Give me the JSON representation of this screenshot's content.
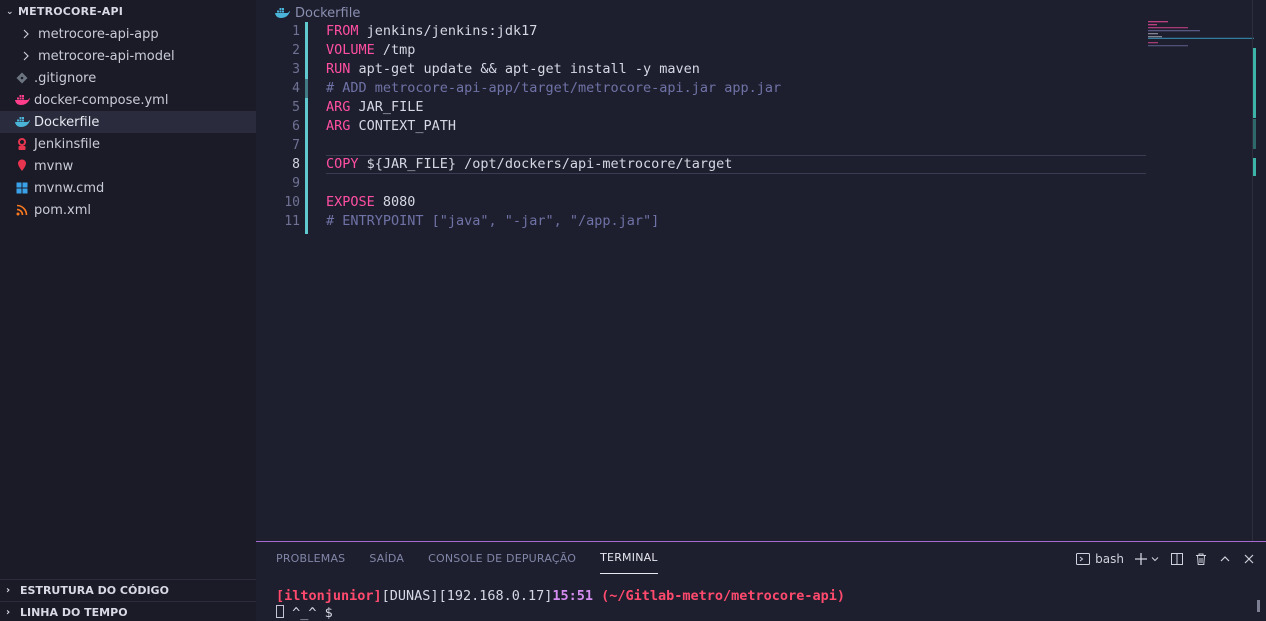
{
  "sidebar": {
    "root_label": "METROCORE-API",
    "items": [
      {
        "label": "metrocore-api-app",
        "kind": "folder",
        "icon": "chevron-right-icon"
      },
      {
        "label": "metrocore-api-model",
        "kind": "folder",
        "icon": "chevron-right-icon"
      },
      {
        "label": ".gitignore",
        "kind": "file",
        "icon": "git-icon",
        "color": "#6b7480"
      },
      {
        "label": "docker-compose.yml",
        "kind": "file",
        "icon": "docker-icon",
        "color": "#ff3d8b"
      },
      {
        "label": "Dockerfile",
        "kind": "file",
        "icon": "docker-icon",
        "color": "#4ab5d9",
        "active": true
      },
      {
        "label": "Jenkinsfile",
        "kind": "file",
        "icon": "jenkins-icon",
        "color": "#e8354f"
      },
      {
        "label": "mvnw",
        "kind": "file",
        "icon": "maven-pin-icon",
        "color": "#e8354f"
      },
      {
        "label": "mvnw.cmd",
        "kind": "file",
        "icon": "windows-icon",
        "color": "#3aa0e8"
      },
      {
        "label": "pom.xml",
        "kind": "file",
        "icon": "rss-icon",
        "color": "#ff7a1f"
      }
    ],
    "outline_label": "ESTRUTURA DO CÓDIGO",
    "timeline_label": "LINHA DO TEMPO"
  },
  "editor": {
    "breadcrumb": "Dockerfile",
    "current_line": 8,
    "lines": [
      {
        "n": "1",
        "kw": "FROM",
        "rest": " jenkins/jenkins:jdk17",
        "comment": ""
      },
      {
        "n": "2",
        "kw": "VOLUME",
        "rest": " /tmp",
        "comment": ""
      },
      {
        "n": "3",
        "kw": "RUN",
        "rest": " apt-get update && apt-get install -y maven",
        "comment": ""
      },
      {
        "n": "4",
        "kw": "",
        "rest": "",
        "comment": "# ADD metrocore-api-app/target/metrocore-api.jar app.jar"
      },
      {
        "n": "5",
        "kw": "ARG",
        "rest": " JAR_FILE",
        "comment": ""
      },
      {
        "n": "6",
        "kw": "ARG",
        "rest": " CONTEXT_PATH",
        "comment": ""
      },
      {
        "n": "7",
        "kw": "",
        "rest": "",
        "comment": ""
      },
      {
        "n": "8",
        "kw": "COPY",
        "rest": " ${JAR_FILE} /opt/dockers/api-metrocore/target",
        "comment": ""
      },
      {
        "n": "9",
        "kw": "",
        "rest": "",
        "comment": ""
      },
      {
        "n": "10",
        "kw": "EXPOSE",
        "rest": " 8080",
        "comment": ""
      },
      {
        "n": "11",
        "kw": "",
        "rest": "",
        "comment": "# ENTRYPOINT [\"java\", \"-jar\", \"/app.jar\"]"
      }
    ]
  },
  "panel": {
    "tabs": [
      "PROBLEMAS",
      "SAÍDA",
      "CONSOLE DE DEPURAÇÃO",
      "TERMINAL"
    ],
    "active_tab": "TERMINAL",
    "shell_label": "bash",
    "terminal": {
      "user": "[iltonjunior]",
      "host": "[DUNAS][192.168.0.17]",
      "time": "15:51",
      "path": " (~/Gitlab-metro/metrocore-api)",
      "prompt": " ^_^ $ "
    }
  },
  "colors": {
    "accent": "#a86ad0",
    "keyword": "#ff4fa3",
    "comment": "#6f72a6",
    "git_modified": "#5fc9cf"
  }
}
